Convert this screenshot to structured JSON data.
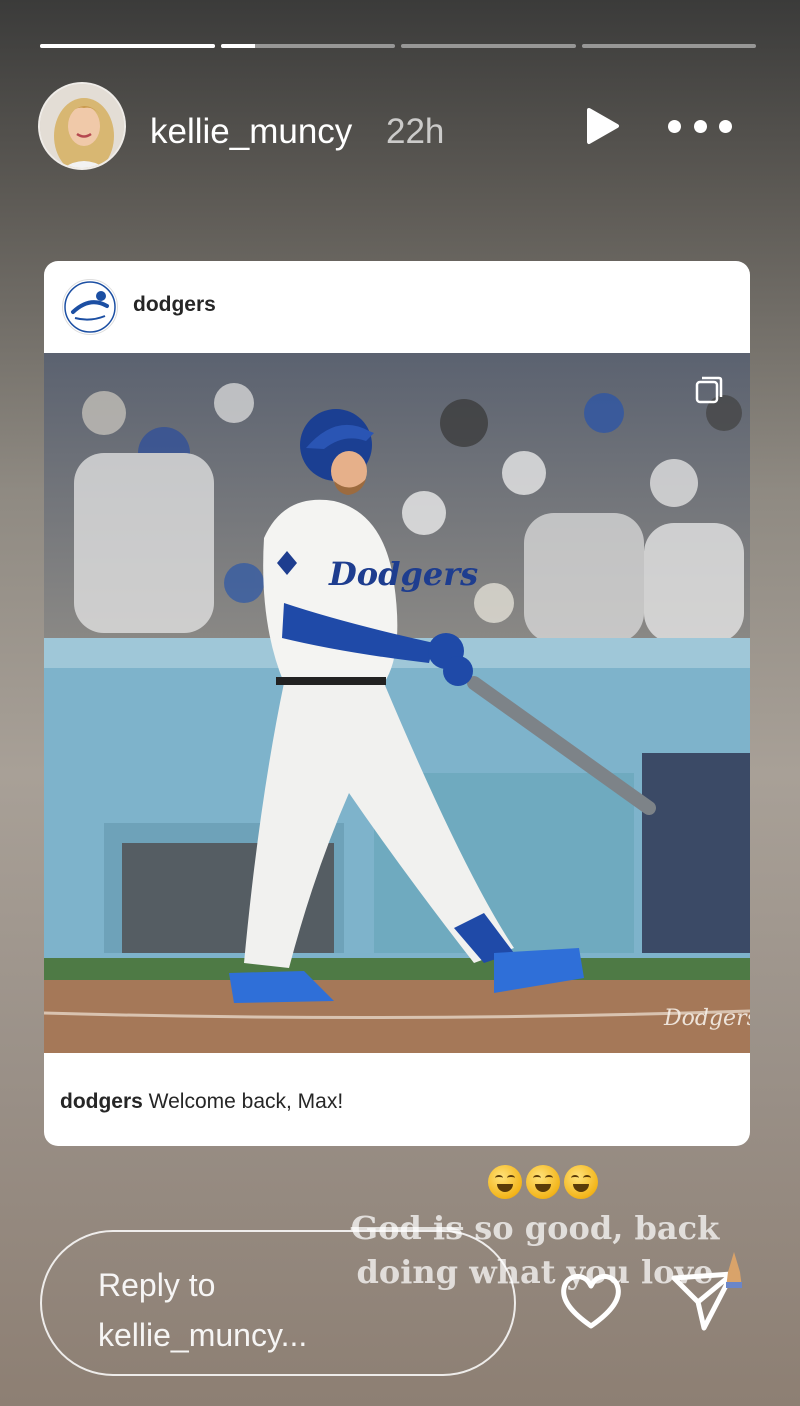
{
  "story": {
    "progress_segments": [
      1,
      0.2,
      0,
      0
    ],
    "username": "kellie_muncy",
    "timestamp": "22h",
    "icons": {
      "avatar": "profile-avatar",
      "play": "play-icon",
      "more": "more-options-icon",
      "heart": "heart-icon",
      "send": "send-icon"
    }
  },
  "post": {
    "username": "dodgers",
    "caption_user": "dodgers",
    "caption_text": " Welcome back, Max!",
    "icons": {
      "logo": "dodgers-logo",
      "carousel": "carousel-icon"
    }
  },
  "overlay": {
    "emojis": [
      "😂",
      "😂",
      "😂"
    ],
    "text_line1_strike": "God is",
    "text_line1_rest": " so good, back",
    "text_line2": "doing what you love"
  },
  "reply": {
    "placeholder_line1": "Reply to",
    "placeholder_line2": "kellie_muncy..."
  }
}
